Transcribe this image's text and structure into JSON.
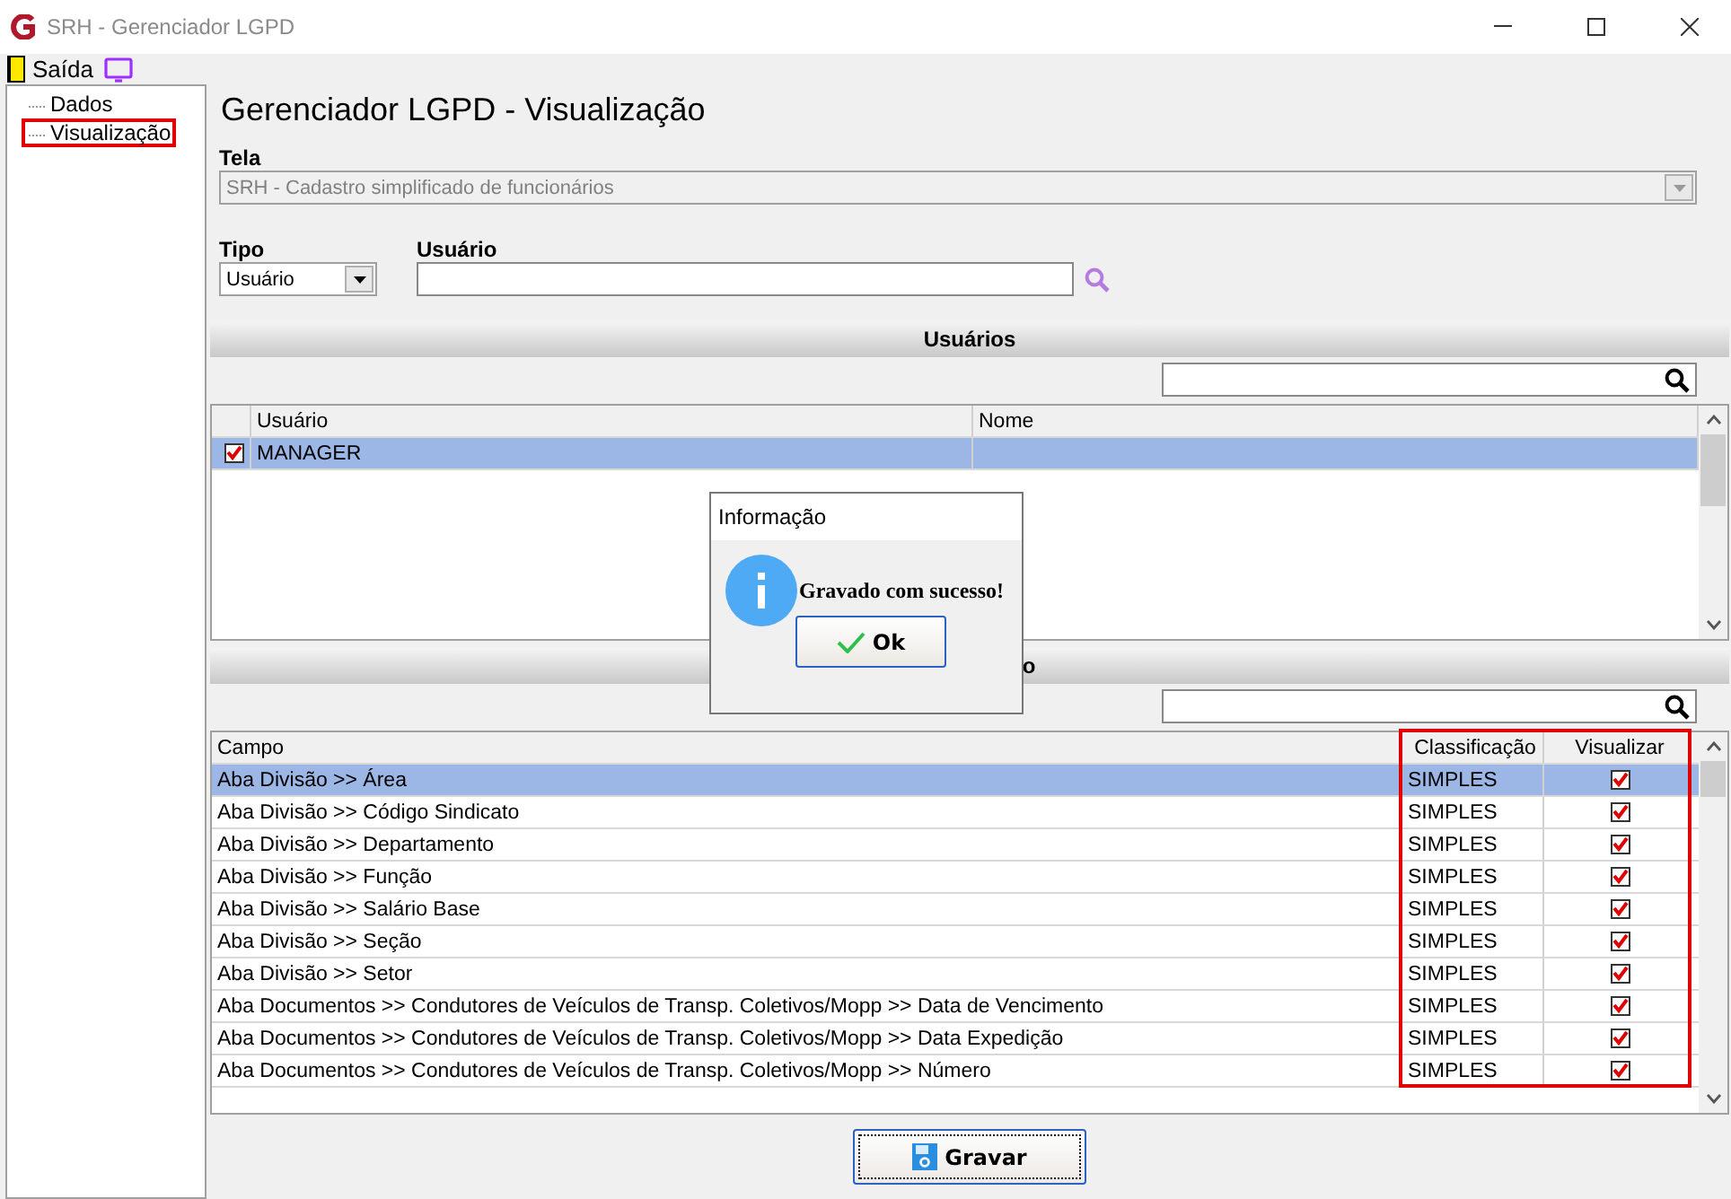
{
  "window": {
    "title": "SRH - Gerenciador LGPD"
  },
  "toolbar": {
    "items": [
      {
        "kind": "exit",
        "label": "Saída"
      },
      {
        "kind": "screen"
      }
    ]
  },
  "tree": {
    "items": [
      {
        "label": "Dados",
        "highlighted": false
      },
      {
        "label": "Visualização",
        "highlighted": true
      }
    ]
  },
  "heading": "Gerenciador LGPD - Visualização",
  "tela": {
    "label": "Tela",
    "value": "SRH - Cadastro simplificado de funcionários",
    "disabled": true
  },
  "tipo": {
    "label": "Tipo",
    "value": "Usuário"
  },
  "usuario": {
    "label": "Usuário"
  },
  "users_section": {
    "title": "Usuários",
    "columns": [
      {
        "label": "Usuário"
      },
      {
        "label": "Nome"
      }
    ],
    "rows": [
      {
        "checked": true,
        "usuario": "MANAGER",
        "selected": true
      }
    ]
  },
  "fields_section": {
    "title": "o",
    "columns": [
      {
        "label": "Campo",
        "highlighted": false
      },
      {
        "label": "Classificação",
        "highlighted": true
      },
      {
        "label": "Visualizar",
        "highlighted": true
      }
    ],
    "rows": [
      {
        "campo": "Aba Divisão >> Área",
        "classificacao": "SIMPLES",
        "checked": true,
        "selected": true
      },
      {
        "campo": "Aba Divisão >> Código Sindicato",
        "classificacao": "SIMPLES",
        "checked": true,
        "selected": false
      },
      {
        "campo": "Aba Divisão >> Departamento",
        "classificacao": "SIMPLES",
        "checked": true,
        "selected": false
      },
      {
        "campo": "Aba Divisão >> Função",
        "classificacao": "SIMPLES",
        "checked": true,
        "selected": false
      },
      {
        "campo": "Aba Divisão >> Salário Base",
        "classificacao": "SIMPLES",
        "checked": true,
        "selected": false
      },
      {
        "campo": "Aba Divisão >> Seção",
        "classificacao": "SIMPLES",
        "checked": true,
        "selected": false
      },
      {
        "campo": "Aba Divisão >> Setor",
        "classificacao": "SIMPLES",
        "checked": true,
        "selected": false
      },
      {
        "campo": "Aba Documentos >>  Condutores de Veículos de Transp. Coletivos/Mopp >> Data de Vencimento",
        "classificacao": "SIMPLES",
        "checked": true,
        "selected": false
      },
      {
        "campo": "Aba Documentos >>  Condutores de Veículos de Transp. Coletivos/Mopp >> Data Expedição",
        "classificacao": "SIMPLES",
        "checked": true,
        "selected": false
      },
      {
        "campo": "Aba Documentos >>  Condutores de Veículos de Transp. Coletivos/Mopp >> Número",
        "classificacao": "SIMPLES",
        "checked": true,
        "selected": false
      }
    ]
  },
  "save_button": {
    "label": "Gravar"
  },
  "dialog": {
    "title": "Informação",
    "message": "Gravado com sucesso!",
    "button": "Ok"
  }
}
